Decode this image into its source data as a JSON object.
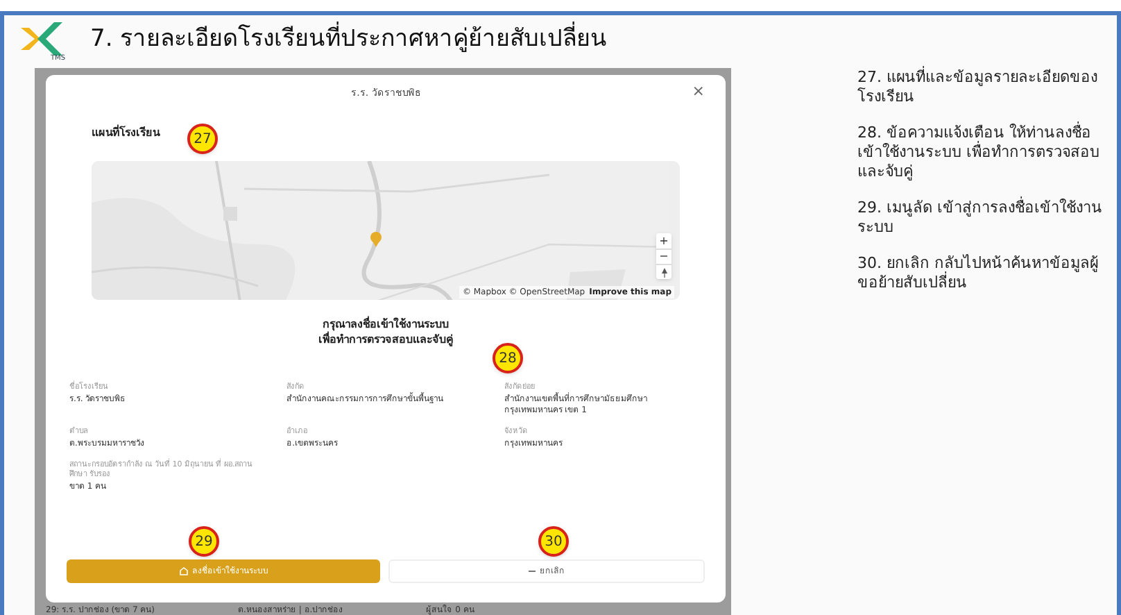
{
  "page_title": "7. รายละเอียดโรงเรียนที่ประกาศหาคู่ย้ายสับเปลี่ยน",
  "logo_caption": "TMS",
  "modal": {
    "title": "ร.ร. วัดราชบพิธ",
    "close": "×",
    "map_heading": "แผนที่โรงเรียน",
    "map": {
      "kind": "picture",
      "zoom_in": "+",
      "zoom_out": "−",
      "attribution": "© Mapbox © OpenStreetMap",
      "improve_link": "Improve this map"
    },
    "notice": [
      "กรุณาลงชื่อเข้าใช้งานระบบ",
      "เพื่อทำการตรวจสอบและจับคู่"
    ],
    "fields": [
      {
        "label": "ชื่อโรงเรียน",
        "value": "ร.ร. วัดราชบพิธ"
      },
      {
        "label": "สังกัด",
        "value": "สำนักงานคณะกรรมการการศึกษาขั้นพื้นฐาน"
      },
      {
        "label": "สังกัดย่อย",
        "value": "สำนักงานเขตพื้นที่การศึกษามัธยมศึกษา กรุงเทพมหานคร เขต 1"
      },
      {
        "label": "ตำบล",
        "value": "ต.พระบรมมหาราชวัง"
      },
      {
        "label": "อำเภอ",
        "value": "อ.เขตพระนคร"
      },
      {
        "label": "จังหวัด",
        "value": "กรุงเทพมหานคร"
      },
      {
        "label": "สถานะกรอบอัตรากำลัง ณ วันที่ 10 มิถุนายน ที่ ผอ.สถานศึกษา รับรอง",
        "value": "ขาด 1 คน"
      }
    ],
    "buttons": [
      {
        "label": "ลงชื่อเข้าใช้งานระบบ",
        "kind": "primary"
      },
      {
        "label": "ยกเลิก",
        "kind": "secondary"
      }
    ]
  },
  "background_row": [
    "29: ร.ร. ปากช่อง (ขาด 7 คน)",
    "ต.หนองสาหร่าย | อ.ปากช่อง",
    "ผู้สนใจ 0 คน"
  ],
  "callouts": [
    "27",
    "28",
    "29",
    "30"
  ],
  "notes": [
    "27. แผนที่และข้อมูลรายละเอียดของโรงเรียน",
    "28. ข้อความแจ้งเตือน ให้ท่านลงชื่อเข้าใช้งานระบบ เพื่อทำการตรวจสอบและจับคู่",
    "29. เมนูลัด เข้าสู่การลงชื่อเข้าใช้งานระบบ",
    "30. ยกเลิก กลับไปหน้าค้นหาข้อมูลผู้ขอย้ายสับเปลี่ยน"
  ]
}
